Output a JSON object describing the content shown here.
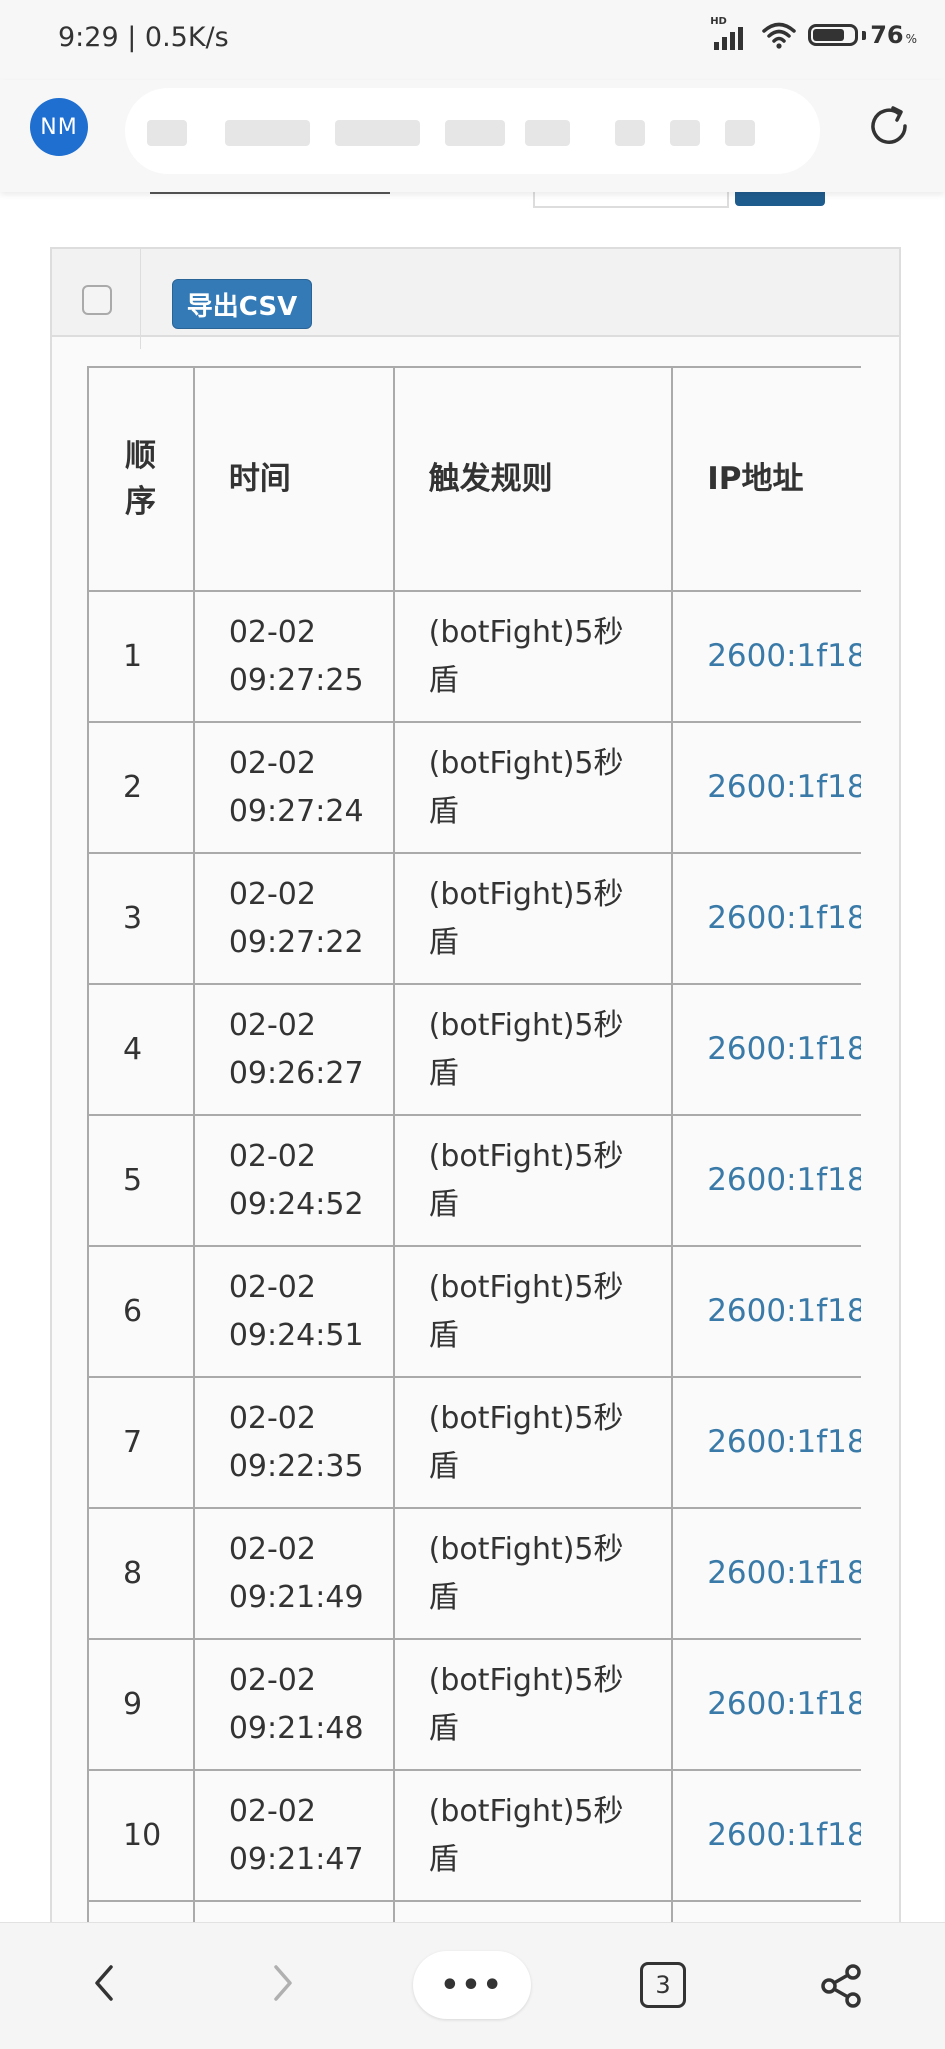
{
  "status_bar": {
    "time_speed": "9:29 | 0.5K/s",
    "network_label": "HD",
    "battery_level": "76",
    "battery_unit": "%"
  },
  "browser": {
    "avatar_initials": "NM",
    "tab_count": "3",
    "menu_label": "•••"
  },
  "panel": {
    "export_label": "导出CSV"
  },
  "table": {
    "headers": [
      "顺序",
      "时间",
      "触发规则",
      "IP地址"
    ],
    "rows": [
      {
        "index": "1",
        "date": "02-02",
        "time": "09:27:25",
        "rule": "(botFight)5秒",
        "rule2": "盾",
        "ip": "2600:1f18"
      },
      {
        "index": "2",
        "date": "02-02",
        "time": "09:27:24",
        "rule": "(botFight)5秒",
        "rule2": "盾",
        "ip": "2600:1f18"
      },
      {
        "index": "3",
        "date": "02-02",
        "time": "09:27:22",
        "rule": "(botFight)5秒",
        "rule2": "盾",
        "ip": "2600:1f18"
      },
      {
        "index": "4",
        "date": "02-02",
        "time": "09:26:27",
        "rule": "(botFight)5秒",
        "rule2": "盾",
        "ip": "2600:1f18"
      },
      {
        "index": "5",
        "date": "02-02",
        "time": "09:24:52",
        "rule": "(botFight)5秒",
        "rule2": "盾",
        "ip": "2600:1f18"
      },
      {
        "index": "6",
        "date": "02-02",
        "time": "09:24:51",
        "rule": "(botFight)5秒",
        "rule2": "盾",
        "ip": "2600:1f18"
      },
      {
        "index": "7",
        "date": "02-02",
        "time": "09:22:35",
        "rule": "(botFight)5秒",
        "rule2": "盾",
        "ip": "2600:1f18"
      },
      {
        "index": "8",
        "date": "02-02",
        "time": "09:21:49",
        "rule": "(botFight)5秒",
        "rule2": "盾",
        "ip": "2600:1f18"
      },
      {
        "index": "9",
        "date": "02-02",
        "time": "09:21:48",
        "rule": "(botFight)5秒",
        "rule2": "盾",
        "ip": "2600:1f18"
      },
      {
        "index": "10",
        "date": "02-02",
        "time": "09:21:47",
        "rule": "(botFight)5秒",
        "rule2": "盾",
        "ip": "2600:1f18"
      }
    ]
  },
  "icons": {
    "reload": "reload-icon",
    "back": "chevron-left-icon",
    "forward": "chevron-right-icon",
    "share": "share-icon"
  },
  "colors": {
    "button_blue": "#337ab7",
    "link_blue": "#3a7aa8",
    "avatar_blue": "#1e6fd0"
  }
}
